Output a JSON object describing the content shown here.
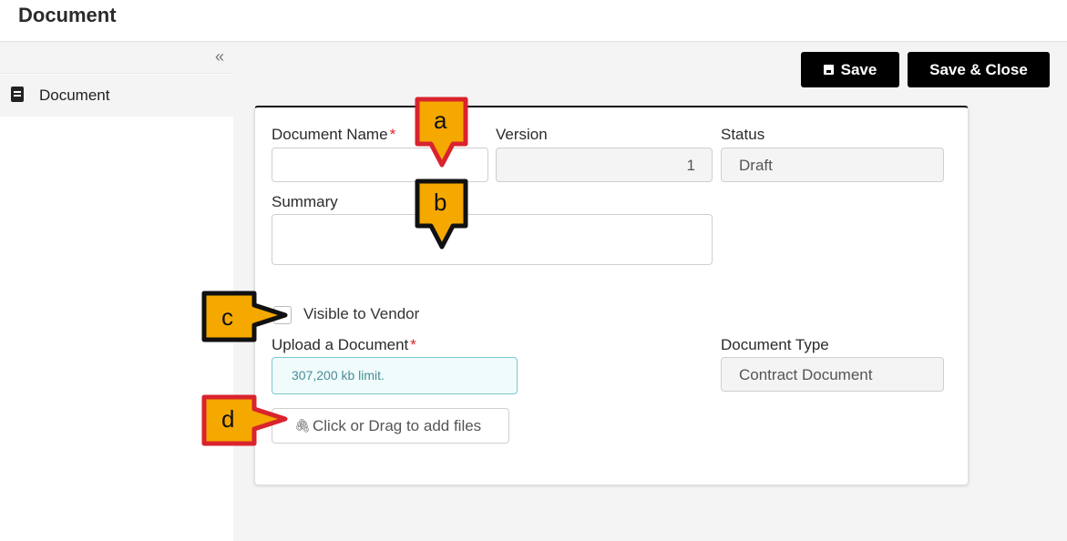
{
  "header": {
    "title": "Document"
  },
  "sidebar": {
    "collapse_icon": "double-chevron-left-icon",
    "collapse_glyph": "«",
    "items": [
      {
        "label": "Document",
        "icon": "book-icon"
      }
    ]
  },
  "toolbar": {
    "save_label": "Save",
    "save_close_label": "Save & Close"
  },
  "form": {
    "document_name": {
      "label": "Document Name",
      "required": "*",
      "value": ""
    },
    "version": {
      "label": "Version",
      "value": "1"
    },
    "status": {
      "label": "Status",
      "value": "Draft"
    },
    "summary": {
      "label": "Summary",
      "value": ""
    },
    "visible_to_vendor": {
      "label": "Visible to Vendor",
      "checked": false
    },
    "upload": {
      "label": "Upload a Document",
      "required": "*",
      "limit_text": "307,200 kb limit.",
      "dropzone_text": "Click or Drag to add files",
      "clip_glyph": "🖇"
    },
    "document_type": {
      "label": "Document Type",
      "value": "Contract Document"
    }
  },
  "callouts": [
    {
      "letter": "a",
      "color": "#f5a800",
      "border": "#d9232d"
    },
    {
      "letter": "b",
      "color": "#f5a800",
      "border": "#111111"
    },
    {
      "letter": "c",
      "color": "#f5a800",
      "border": "#111111"
    },
    {
      "letter": "d",
      "color": "#f5a800",
      "border": "#d9232d"
    }
  ],
  "colors": {
    "accent": "#000000",
    "required": "#d9232d",
    "info_border": "#7fc7cf",
    "info_text": "#4a8d98"
  }
}
